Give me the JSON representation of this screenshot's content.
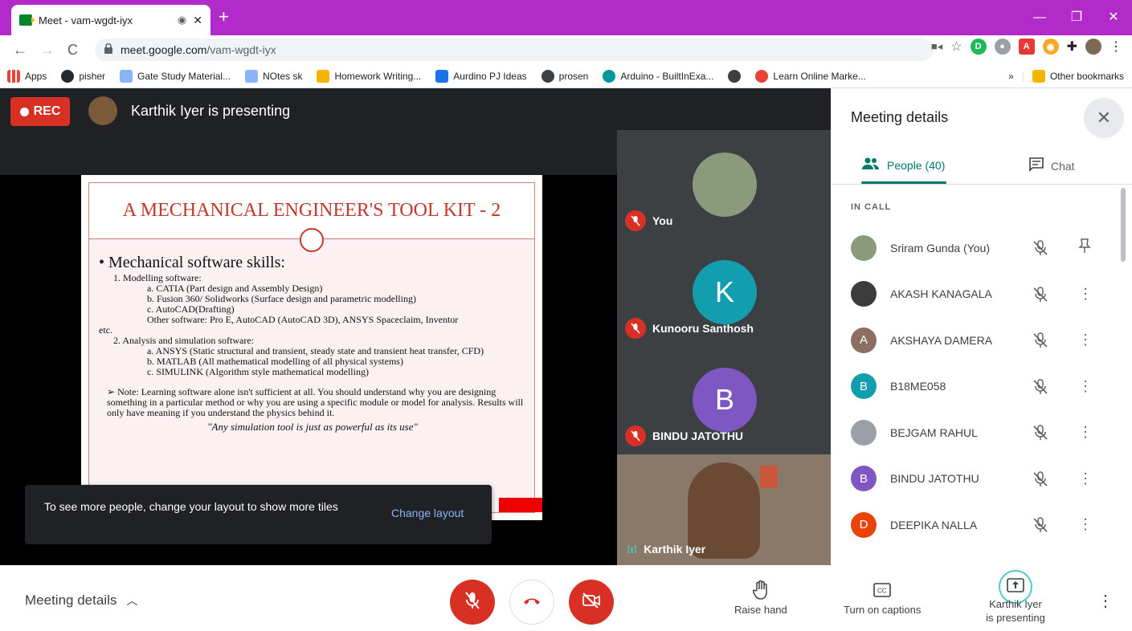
{
  "browser": {
    "tab_title": "Meet - vam-wgdt-iyx",
    "url_host": "meet.google.com",
    "url_path": "/vam-wgdt-iyx",
    "bookmarks": [
      {
        "label": "Apps",
        "color": "#4285f4"
      },
      {
        "label": "pisher",
        "color": "#202124"
      },
      {
        "label": "Gate Study Material...",
        "color": "#8ab4f8"
      },
      {
        "label": "NOtes sk",
        "color": "#8ab4f8"
      },
      {
        "label": "Homework Writing...",
        "color": "#f4b400"
      },
      {
        "label": "Aurdino PJ Ideas",
        "color": "#1a73e8"
      },
      {
        "label": "prosen",
        "color": "#3c4043"
      },
      {
        "label": "Arduino - BuiltInExa...",
        "color": "#00979c"
      },
      {
        "label": "",
        "color": "#3c4043"
      },
      {
        "label": "Learn Online Marke...",
        "color": "#ea4335"
      }
    ],
    "more_bookmarks": "»",
    "other_bookmarks": "Other bookmarks"
  },
  "meet": {
    "rec_label": "REC",
    "presenting_text": "Karthik Iyer is presenting",
    "slide": {
      "title": "A MECHANICAL ENGINEER'S TOOL KIT - 2",
      "bullet": "Mechanical software skills:",
      "lines": [
        {
          "cls": "l1",
          "text": "1. Modelling software:"
        },
        {
          "cls": "l2",
          "text": "a. CATIA (Part design and Assembly Design)"
        },
        {
          "cls": "l2",
          "text": "b. Fusion 360/ Solidworks (Surface design and parametric modelling)"
        },
        {
          "cls": "l2",
          "text": "c. AutoCAD(Drafting)"
        },
        {
          "cls": "l2",
          "text": "Other software: Pro E, AutoCAD (AutoCAD 3D), ANSYS Spaceclaim,     Inventor"
        },
        {
          "cls": "",
          "text": "etc."
        },
        {
          "cls": "l1",
          "text": "2. Analysis and simulation software:"
        },
        {
          "cls": "l2",
          "text": "a. ANSYS (Static structural and transient, steady state and transient heat transfer,  CFD)"
        },
        {
          "cls": "l2",
          "text": "b. MATLAB (All mathematical modelling of all physical systems)"
        },
        {
          "cls": "l2",
          "text": "c. SIMULINK (Algorithm style mathematical modelling)"
        }
      ],
      "note": "Note: Learning software alone isn't sufficient at all. You should understand why you are designing something in a particular method or why you are using a specific module or model for analysis.  Results will only have meaning if you understand the physics behind it.",
      "quote": "\"Any simulation tool is just as powerful as its use\""
    },
    "tiles": [
      {
        "name": "You",
        "initial": "",
        "color": "#7d8a6a"
      },
      {
        "name": "Kunooru Santhosh",
        "initial": "K",
        "color": "#129eaf"
      },
      {
        "name": "BINDU JATOTHU",
        "initial": "B",
        "color": "#7e57c2"
      }
    ],
    "camera_tile_name": "Karthik Iyer",
    "snackbar": {
      "message": "To see more people, change your layout to show more tiles",
      "action": "Change layout"
    },
    "panel": {
      "title": "Meeting details",
      "people_tab": "People (40)",
      "chat_tab": "Chat",
      "in_call_label": "IN CALL",
      "people": [
        {
          "name": "Sriram Gunda (You)",
          "initial": "",
          "color": "#8a9a7a",
          "action": "pin"
        },
        {
          "name": "AKASH KANAGALA",
          "initial": "",
          "color": "#3c3c3c",
          "action": "more"
        },
        {
          "name": "AKSHAYA DAMERA",
          "initial": "A",
          "color": "#8d6e63",
          "action": "more"
        },
        {
          "name": "B18ME058",
          "initial": "B",
          "color": "#129eaf",
          "action": "more"
        },
        {
          "name": "BEJGAM RAHUL",
          "initial": "",
          "color": "#9aa0a6",
          "action": "more"
        },
        {
          "name": "BINDU JATOTHU",
          "initial": "B",
          "color": "#7e57c2",
          "action": "more"
        },
        {
          "name": "DEEPIKA NALLA",
          "initial": "D",
          "color": "#e8430a",
          "action": "more"
        }
      ]
    },
    "bottom": {
      "meeting_details": "Meeting details",
      "raise_hand": "Raise hand",
      "captions": "Turn on captions",
      "presenting_line1": "Karthik Iyer",
      "presenting_line2": "is presenting"
    }
  }
}
